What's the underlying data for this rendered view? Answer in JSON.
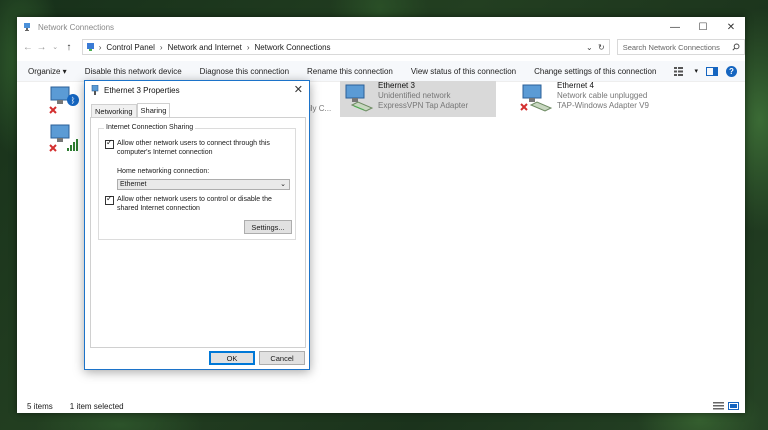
{
  "window": {
    "title": "Network Connections",
    "controls": {
      "minimize": "—",
      "maximize": "☐",
      "close": "✕"
    }
  },
  "address": {
    "breadcrumb": [
      "Control Panel",
      "Network and Internet",
      "Network Connections"
    ],
    "search_placeholder": "Search Network Connections"
  },
  "toolbar": {
    "organize": "Organize ▾",
    "commands": [
      "Disable this network device",
      "Diagnose this connection",
      "Rename this connection",
      "View status of this connection",
      "Change settings of this connection"
    ]
  },
  "connections": [
    {
      "name": "Ethernet 3",
      "status": "Unidentified network",
      "adapter": "ExpressVPN Tap Adapter",
      "selected": true
    },
    {
      "name": "Ethernet 4",
      "status": "Network cable unplugged",
      "adapter": "TAP-Windows Adapter V9",
      "selected": false
    },
    {
      "partial_text": "ily C..."
    }
  ],
  "statusbar": {
    "items": "5 items",
    "selected": "1 item selected"
  },
  "dialog": {
    "title": "Ethernet 3 Properties",
    "tabs": [
      "Networking",
      "Sharing"
    ],
    "active_tab": "Sharing",
    "group_label": "Internet Connection Sharing",
    "allow_connect_label_1": "Allow other network users to connect through this",
    "allow_connect_label_2": "computer's Internet connection",
    "allow_connect_checked": true,
    "home_network_label": "Home networking connection:",
    "home_network_value": "Ethernet",
    "allow_control_label_1": "Allow other network users to control or disable the",
    "allow_control_label_2": "shared Internet connection",
    "allow_control_checked": true,
    "settings_button": "Settings...",
    "ok_button": "OK",
    "cancel_button": "Cancel"
  },
  "colors": {
    "accent": "#0078d7",
    "selection": "#d9d9d9",
    "error_x": "#d32f2f",
    "help": "#1565c0"
  }
}
